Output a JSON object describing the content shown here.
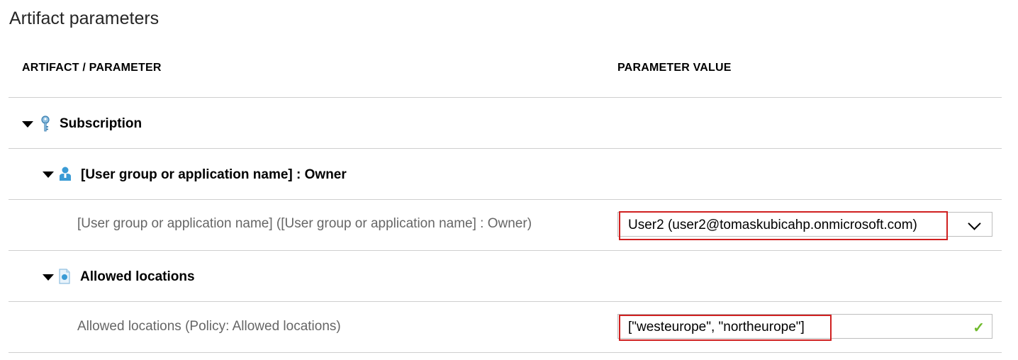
{
  "section_title": "Artifact parameters",
  "columns": {
    "artifact_parameter": "ARTIFACT / PARAMETER",
    "parameter_value": "PARAMETER VALUE"
  },
  "subscription": {
    "label": "Subscription",
    "icon": "key-icon"
  },
  "role_assignment": {
    "label": "[User group or application name] : Owner",
    "icon": "user-icon",
    "parameter_label": "[User group or application name] ([User group or application name] : Owner)",
    "parameter_value": "User2 (user2@tomaskubicahp.onmicrosoft.com)"
  },
  "policy": {
    "label": "Allowed locations",
    "icon": "policy-icon",
    "parameter_label": "Allowed locations (Policy: Allowed locations)",
    "parameter_value": "[\"westeurope\", \"northeurope\"]"
  },
  "colors": {
    "highlight": "#d02020",
    "valid_check": "#6fba2c",
    "icon_blue": "#3a9bd5"
  }
}
